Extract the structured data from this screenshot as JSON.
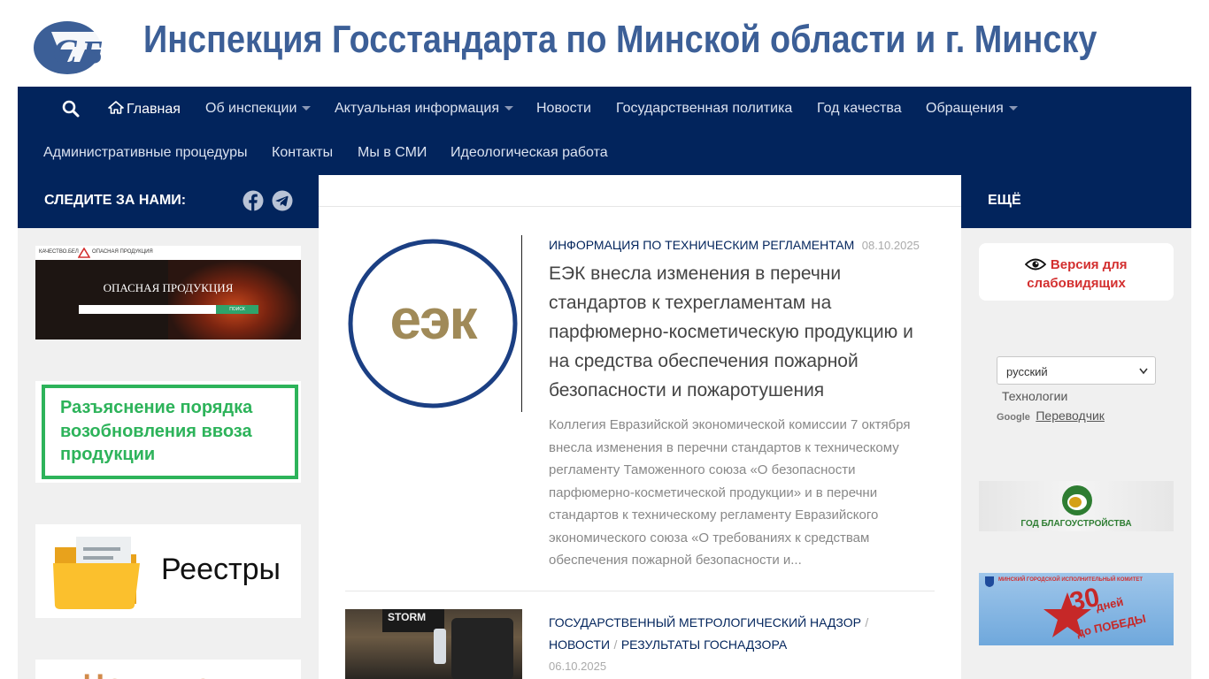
{
  "header": {
    "site_title": "Инспекция Госстандарта по Минской области и г. Минску",
    "brand_color": "#3c5f97"
  },
  "nav": {
    "search_icon": "search-icon",
    "row1": [
      {
        "label": "Главная",
        "active": true,
        "icon": "home-icon"
      },
      {
        "label": "Об инспекции",
        "dropdown": true
      },
      {
        "label": "Актуальная информация",
        "dropdown": true
      },
      {
        "label": "Новости"
      },
      {
        "label": "Государственная политика"
      },
      {
        "label": "Год качества"
      },
      {
        "label": "Обращения",
        "dropdown": true
      }
    ],
    "row2": [
      {
        "label": "Административные процедуры"
      },
      {
        "label": "Контакты"
      },
      {
        "label": "Мы в СМИ"
      },
      {
        "label": "Идеологическая работа"
      }
    ],
    "bg_color": "#02245c"
  },
  "left_sidebar": {
    "follow_label": "СЛЕДИТЕ ЗА НАМИ:",
    "social": [
      "facebook-icon",
      "telegram-icon"
    ],
    "banner1": {
      "top_left": "КАЧЕСТВО.БЕЛ",
      "top_right": "ОПАСНАЯ ПРОДУКЦИЯ",
      "center": "ОПАСНАЯ ПРОДУКЦИЯ",
      "button": "ПОИСК"
    },
    "banner2": {
      "text": "Разъяснение порядка возобновления ввоза продукции"
    },
    "banner3": {
      "text": "Реестры"
    },
    "banner4": {
      "text": "Чек-листы"
    }
  },
  "posts": [
    {
      "category": "ИНФОРМАЦИЯ ПО ТЕХНИЧЕСКИМ РЕГЛАМЕНТАМ",
      "date": "08.10.2025",
      "thumb_text": "еэк",
      "title": "ЕЭК внесла изменения в перечни стандартов к техрегламентам на парфюмерно-косметическую продукцию и на средства обеспечения пожарной безопасности и пожаротушения",
      "excerpt": "Коллегия Евразийской экономической комиссии 7 октября внесла изменения в перечни стандартов к техническому регламенту Таможенного союза «О безопасности парфюмерно-косметической продукции» и в перечни стандартов к техническому регламенту Евразийского экономического союза «О требованиях к средствам обеспечения пожарной безопасности и..."
    },
    {
      "categories": [
        "ГОСУДАРСТВЕННЫЙ МЕТРОЛОГИЧЕСКИЙ НАДЗОР",
        "НОВОСТИ",
        "РЕЗУЛЬТАТЫ ГОСНАДЗОРА"
      ],
      "separator": "/",
      "date": "06.10.2025",
      "thumb_text": "STORM"
    }
  ],
  "right_sidebar": {
    "head_title": "ЕЩЁ",
    "accessibility": "Версия для слабовидящих",
    "language_select": "русский",
    "translate_tech": "Технологии",
    "translate_brand": "Google",
    "translate_link": "Переводчик",
    "banner1": "ГОД БЛАГОУСТРОЙСТВА",
    "banner2_top": "МИНСКИЙ ГОРОДСКОЙ ИСПОЛНИТЕЛЬНЫЙ КОМИТЕТ",
    "banner2_num": "30",
    "banner2_days": "дней",
    "banner2_sub": "до ПОБЕДЫ"
  }
}
